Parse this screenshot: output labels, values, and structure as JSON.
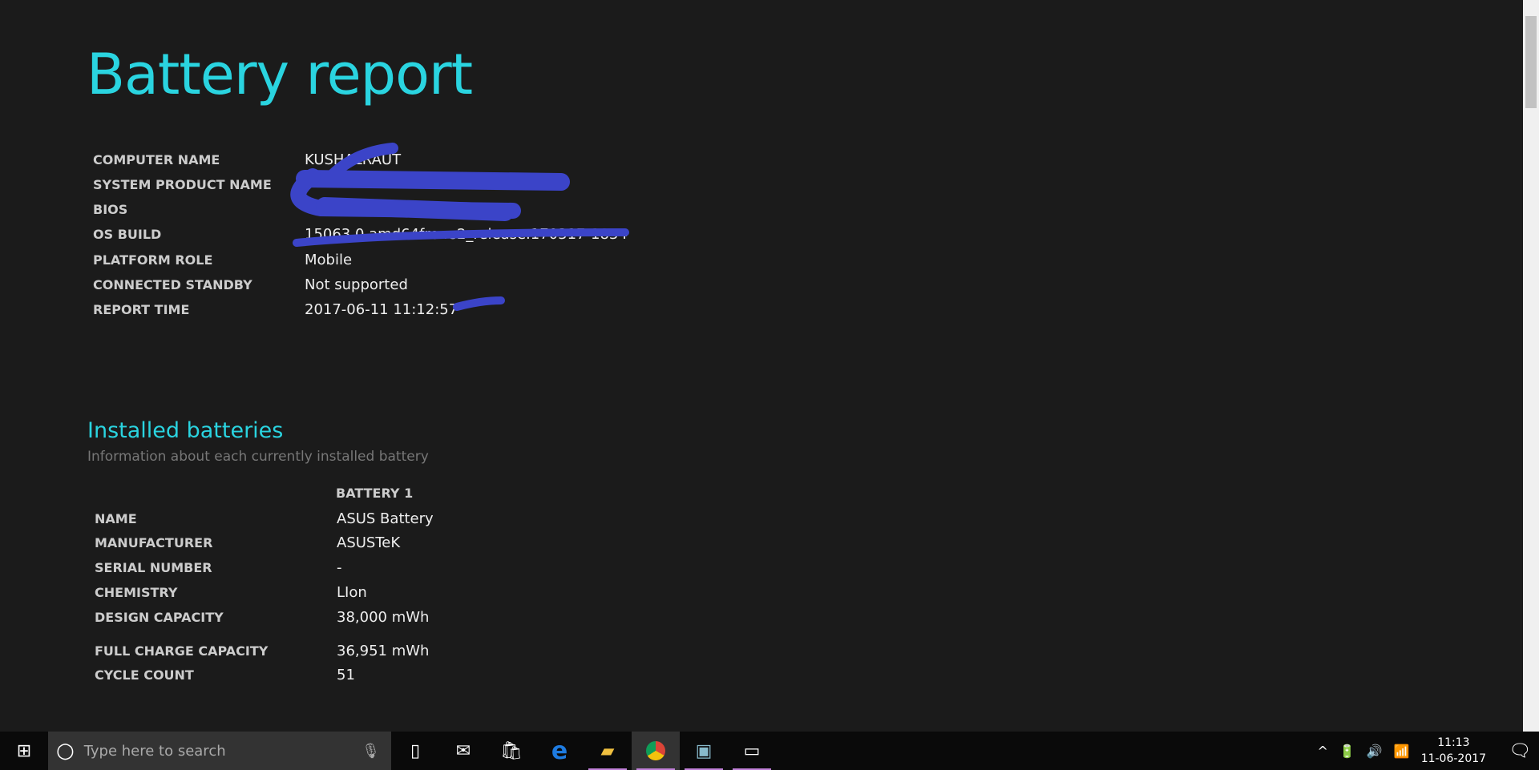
{
  "title": "Battery report",
  "system_info": [
    {
      "label": "COMPUTER NAME",
      "value": "KUSHALRAUT"
    },
    {
      "label": "SYSTEM PRODUCT NAME",
      "value": ""
    },
    {
      "label": "BIOS",
      "value": ""
    },
    {
      "label": "OS BUILD",
      "value": "15063.0.amd64fre.rs2_release.170317-1834"
    },
    {
      "label": "PLATFORM ROLE",
      "value": "Mobile"
    },
    {
      "label": "CONNECTED STANDBY",
      "value": "Not supported"
    },
    {
      "label": "REPORT TIME",
      "value": "2017-06-11  11:12:57"
    }
  ],
  "installed": {
    "heading": "Installed batteries",
    "subtitle": "Information about each currently installed battery",
    "column": "BATTERY 1",
    "rows": [
      {
        "label": "NAME",
        "value": "ASUS Battery"
      },
      {
        "label": "MANUFACTURER",
        "value": "ASUSTeK"
      },
      {
        "label": "SERIAL NUMBER",
        "value": "-"
      },
      {
        "label": "CHEMISTRY",
        "value": "LIon"
      },
      {
        "label": "DESIGN CAPACITY",
        "value": "38,000 mWh"
      },
      {
        "label": "FULL CHARGE CAPACITY",
        "value": "36,951 mWh"
      },
      {
        "label": "CYCLE COUNT",
        "value": "51"
      }
    ]
  },
  "taskbar": {
    "search_placeholder": "Type here to search",
    "time": "11:13",
    "date": "11-06-2017"
  },
  "colors": {
    "accent": "#2ad4e0",
    "redaction": "#3b44c8"
  }
}
